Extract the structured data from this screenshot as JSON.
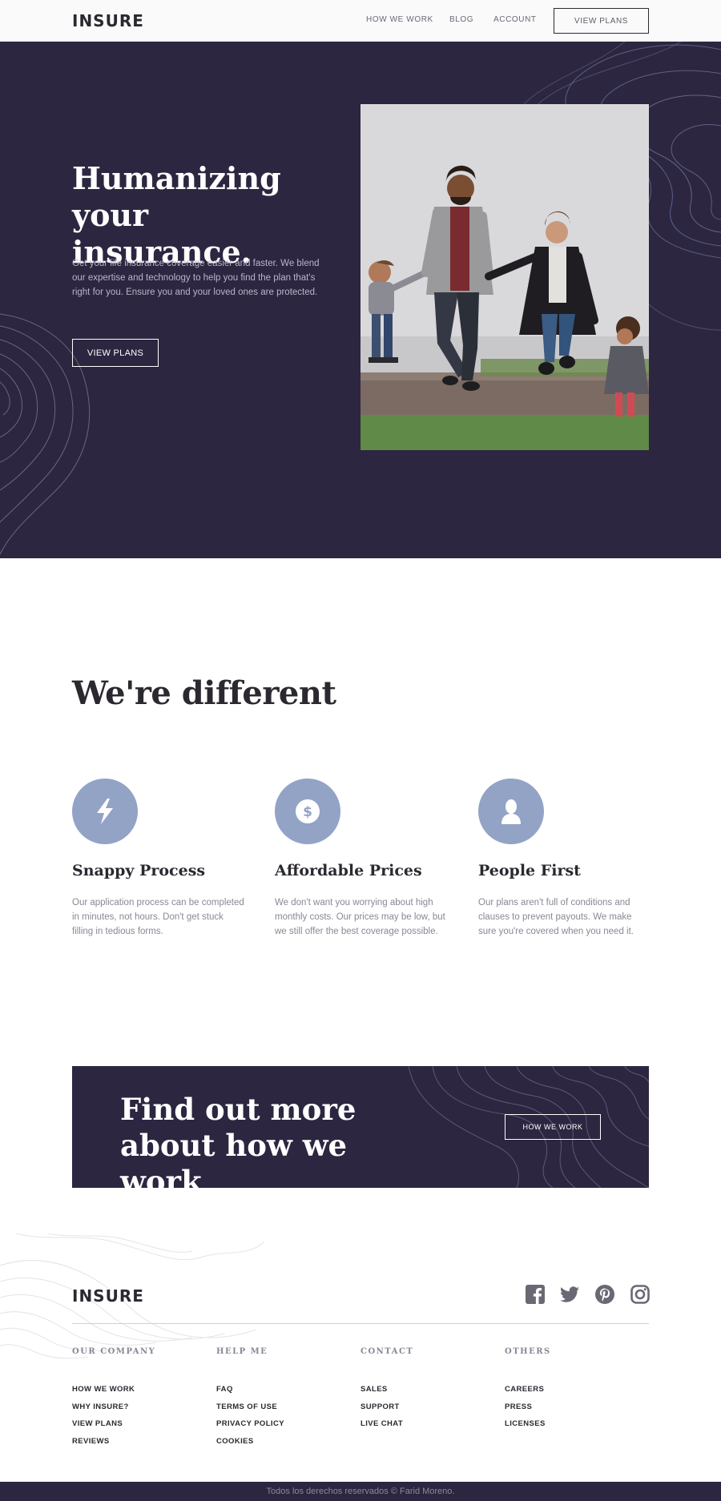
{
  "header": {
    "logo": "INSURE",
    "nav": [
      "HOW WE WORK",
      "BLOG",
      "ACCOUNT"
    ],
    "cta": "VIEW PLANS"
  },
  "hero": {
    "title_line1": "Humanizing",
    "title_line2": "your insurance.",
    "text": "Get your life insurance coverage easier and faster. We blend our expertise and technology to help you find the plan that's right for you. Ensure you and your loved ones are protected.",
    "button": "VIEW PLANS"
  },
  "features": {
    "title": "We're different",
    "items": [
      {
        "icon": "lightning-icon",
        "title": "Snappy Process",
        "text": "Our application process can be completed in minutes, not hours. Don't get stuck filling in tedious forms."
      },
      {
        "icon": "dollar-icon",
        "title": "Affordable Prices",
        "text": "We don't want you worrying about high monthly costs. Our prices may be low, but we still offer the best coverage possible."
      },
      {
        "icon": "person-icon",
        "title": "People First",
        "text": "Our plans aren't full of conditions and clauses to prevent payouts. We make sure you're covered when you need it."
      }
    ]
  },
  "cta": {
    "title_line1": "Find out more",
    "title_line2": "about how we work",
    "button": "HOW WE WORK"
  },
  "footer": {
    "logo": "INSURE",
    "social": [
      "facebook-icon",
      "twitter-icon",
      "pinterest-icon",
      "instagram-icon"
    ],
    "columns": [
      {
        "heading": "OUR COMPANY",
        "links": [
          "HOW WE WORK",
          "WHY INSURE?",
          "VIEW PLANS",
          "REVIEWS"
        ]
      },
      {
        "heading": "HELP ME",
        "links": [
          "FAQ",
          "TERMS OF USE",
          "PRIVACY POLICY",
          "COOKIES"
        ]
      },
      {
        "heading": "CONTACT",
        "links": [
          "SALES",
          "SUPPORT",
          "LIVE CHAT"
        ]
      },
      {
        "heading": "OTHERS",
        "links": [
          "CAREERS",
          "PRESS",
          "LICENSES"
        ]
      }
    ],
    "copyright": "Todos los derechos reservados © Farid Moreno."
  },
  "colors": {
    "dark_violet": "#2c2640",
    "grayish_blue": "#93a3c6",
    "text_gray": "#8a8794"
  }
}
